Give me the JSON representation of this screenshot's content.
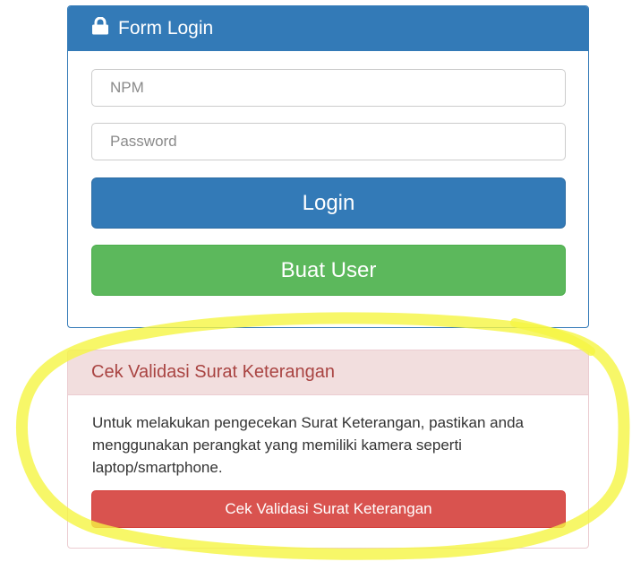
{
  "login_form": {
    "title": "Form Login",
    "icon": "lock-icon",
    "npm_placeholder": "NPM",
    "password_placeholder": "Password",
    "login_label": "Login",
    "register_label": "Buat User"
  },
  "validation": {
    "title": "Cek Validasi Surat Keterangan",
    "description": "Untuk melakukan pengecekan Surat Keterangan, pastikan anda menggunakan perangkat yang memiliki kamera seperti laptop/smartphone.",
    "button_label": "Cek Validasi Surat Keterangan"
  },
  "colors": {
    "primary": "#337ab7",
    "success": "#5cb85c",
    "danger": "#d9534f",
    "danger_heading_bg": "#f2dede",
    "danger_heading_text": "#a94442",
    "highlight": "#f5f542"
  }
}
